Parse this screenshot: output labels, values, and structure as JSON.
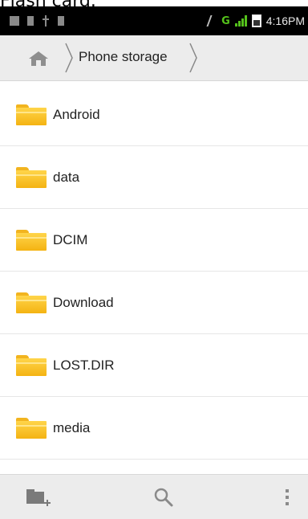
{
  "window": {
    "caption_fragment": "Flash card."
  },
  "status_bar": {
    "network_type": "G",
    "time": "4:16PM",
    "icons": [
      "notification-icon",
      "sd-card-icon",
      "usb-icon",
      "notification-icon",
      "bluetooth-icon",
      "signal-icon",
      "battery-icon"
    ]
  },
  "breadcrumb": {
    "home_icon": "home-icon",
    "current": "Phone storage"
  },
  "files": [
    {
      "name": "Android",
      "icon": "folder-icon"
    },
    {
      "name": "data",
      "icon": "folder-icon"
    },
    {
      "name": "DCIM",
      "icon": "folder-icon"
    },
    {
      "name": "Download",
      "icon": "folder-icon"
    },
    {
      "name": "LOST.DIR",
      "icon": "folder-icon"
    },
    {
      "name": "media",
      "icon": "folder-icon"
    }
  ],
  "toolbar": {
    "new_folder_icon": "new-folder-icon",
    "search_icon": "search-icon",
    "overflow_icon": "overflow-menu-icon"
  },
  "colors": {
    "status_bar": "#000000",
    "action_bar": "#ececec",
    "folder": "#f4b312",
    "network": "#55c21b"
  }
}
